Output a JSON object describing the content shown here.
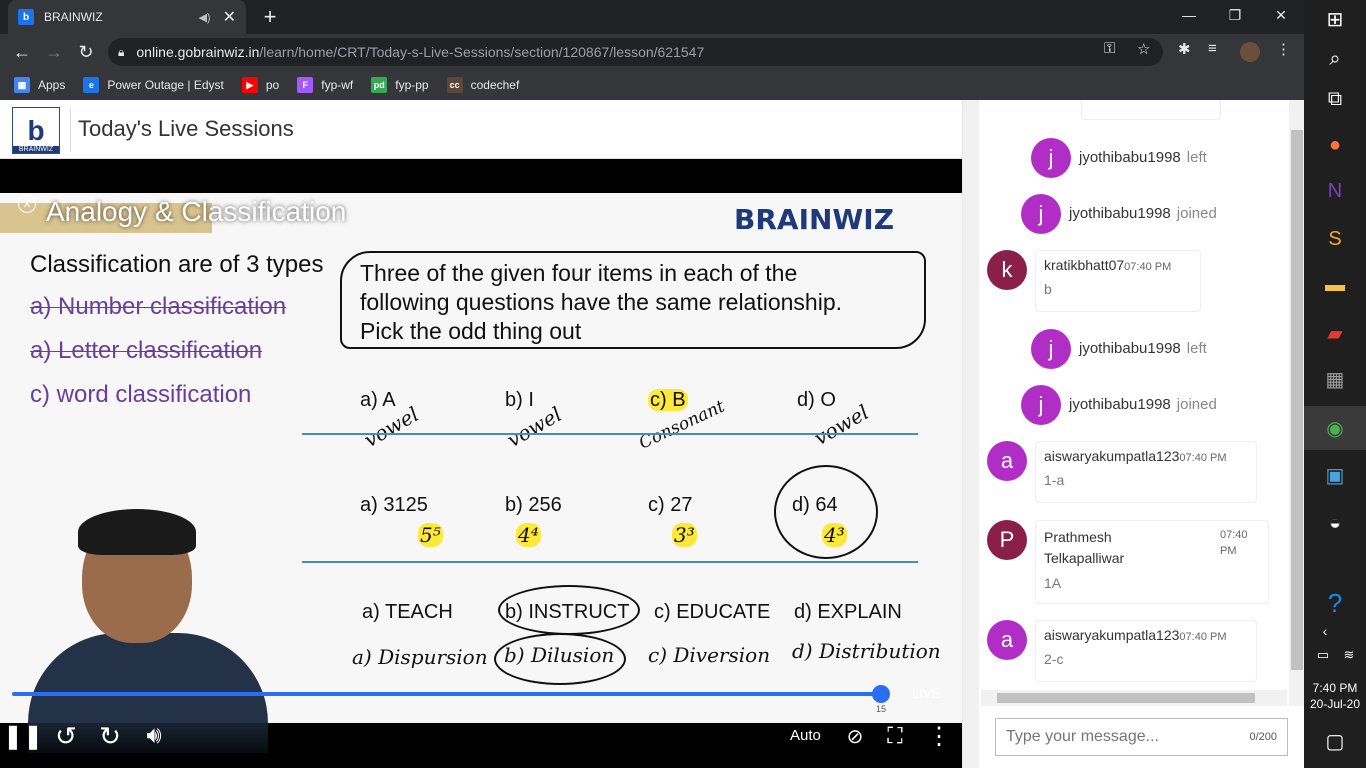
{
  "browser": {
    "tab_title": "BRAINWIZ",
    "tab_favicon": "b",
    "url_host": "online.gobrainwiz.in",
    "url_path": "/learn/home/CRT/Today-s-Live-Sessions/section/120867/lesson/621547",
    "bookmarks": [
      {
        "label": "Apps",
        "icon": "grid-icon",
        "color": "#f28b82"
      },
      {
        "label": "Power Outage | Edyst",
        "icon": "edyst-icon",
        "color": "#1a73e8"
      },
      {
        "label": "po",
        "icon": "youtube-icon",
        "color": "#ff0000"
      },
      {
        "label": "fyp-wf",
        "icon": "figma-icon",
        "color": "#a259ff"
      },
      {
        "label": "fyp-pp",
        "icon": "pd-icon",
        "color": "#34a853"
      },
      {
        "label": "codechef",
        "icon": "codechef-icon",
        "color": "#5b4638"
      }
    ]
  },
  "header": {
    "title": "Today's Live Sessions",
    "logo_text": "BRAINWIZ"
  },
  "video": {
    "lesson_title": "Analogy & Classification",
    "brand": "BRAINWIZ",
    "types_title": "Classification are of 3 types",
    "types": [
      "a) Number classification",
      "a) Letter classification",
      "c) word classification"
    ],
    "question_line1": "Three of the given four items in each of the",
    "question_line2": "following questions have the same relationship.",
    "question_line3": "Pick the odd thing out",
    "row1": [
      "a) A",
      "b) I",
      "c) B",
      "d) O"
    ],
    "row1_notes": [
      "vowel",
      "vowel",
      "Consonant",
      "vowel"
    ],
    "row2": [
      "a) 3125",
      "b) 256",
      "c) 27",
      "d) 64"
    ],
    "row2_notes": [
      "5⁵",
      "4⁴",
      "3³",
      "4³"
    ],
    "row3": [
      "a) TEACH",
      "b) INSTRUCT",
      "c) EDUCATE",
      "d) EXPLAIN"
    ],
    "row4": [
      "a) Dispursion",
      "b) Dilusion",
      "c) Diversion",
      "d) Distribution"
    ],
    "live_label": "LIVE",
    "progress_count": "15",
    "quality": "Auto"
  },
  "chat": {
    "messages": [
      {
        "type": "system",
        "avatar": "j",
        "name": "jyothibabu1998",
        "action": "left",
        "color": "#b02ec6"
      },
      {
        "type": "system",
        "avatar": "j",
        "name": "jyothibabu1998",
        "action": "joined",
        "color": "#b02ec6"
      },
      {
        "type": "message",
        "avatar": "k",
        "name": "kratikbhatt07",
        "time": "07:40 PM",
        "text": "b",
        "color": "#8a1f4a"
      },
      {
        "type": "system",
        "avatar": "j",
        "name": "jyothibabu1998",
        "action": "left",
        "color": "#b02ec6"
      },
      {
        "type": "system",
        "avatar": "j",
        "name": "jyothibabu1998",
        "action": "joined",
        "color": "#b02ec6"
      },
      {
        "type": "message",
        "avatar": "a",
        "name": "aiswaryakumpatla123",
        "time": "07:40 PM",
        "text": "1-a",
        "color": "#b02ec6"
      },
      {
        "type": "message",
        "avatar": "P",
        "name": "Prathmesh Telkapalliwar",
        "time": "07:40 PM",
        "text": "1A",
        "color": "#8a1f4a"
      },
      {
        "type": "message",
        "avatar": "a",
        "name": "aiswaryakumpatla123",
        "time": "07:40 PM",
        "text": "2-c",
        "color": "#b02ec6"
      }
    ],
    "input_placeholder": "Type your message...",
    "counter": "0/200"
  },
  "taskbar": {
    "time": "7:40 PM",
    "date": "20-Jul-20"
  }
}
